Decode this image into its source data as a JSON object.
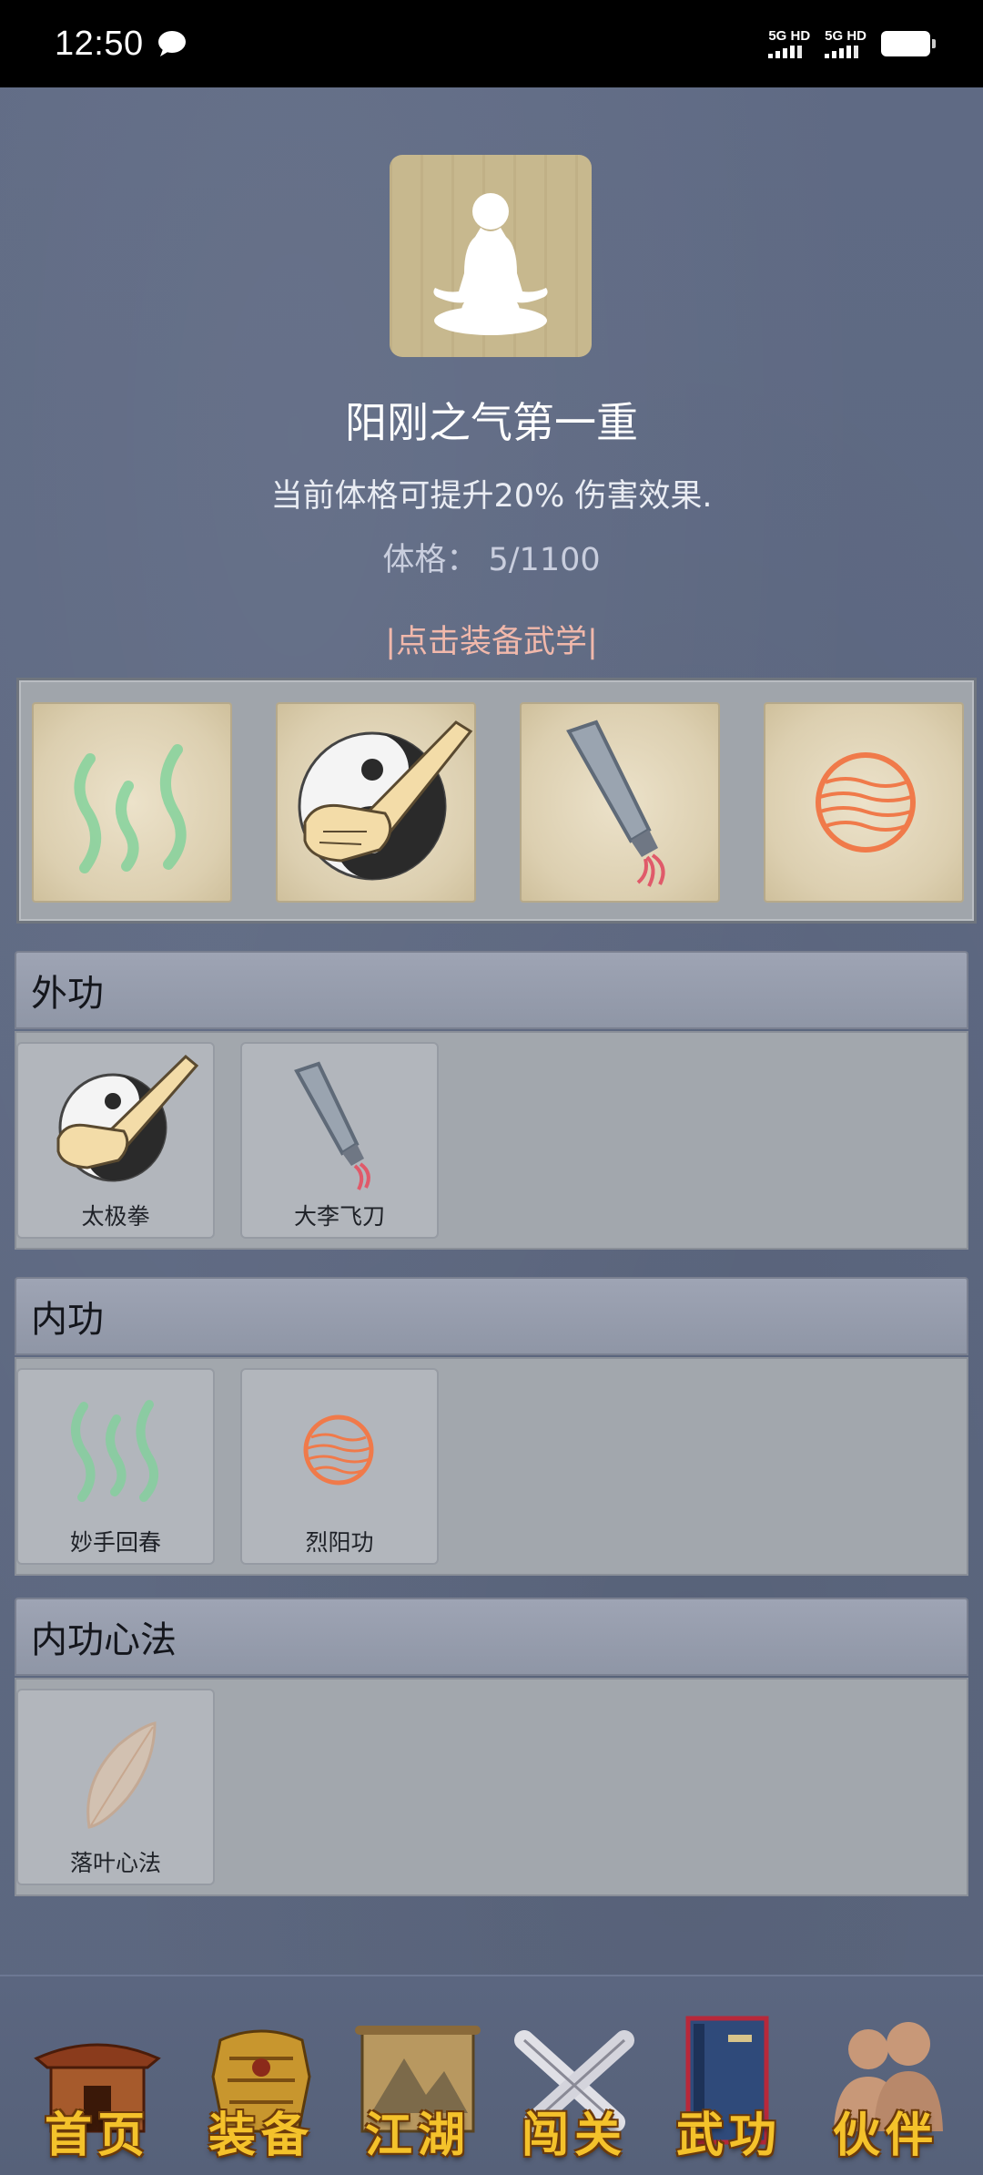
{
  "status_bar": {
    "time": "12:50",
    "network1": "5G HD",
    "network2": "5G HD",
    "icons": [
      "message-icon",
      "signal-icon",
      "battery-icon"
    ]
  },
  "header": {
    "title": "阳刚之气第一重",
    "description": "当前体格可提升20% 伤害效果.",
    "stat_text": "体格： 5/1100",
    "equip_hint": "|点击装备武学|"
  },
  "equipped_slots": [
    {
      "icon": "green-wisps-icon"
    },
    {
      "icon": "taiji-fist-icon"
    },
    {
      "icon": "flying-blade-icon"
    },
    {
      "icon": "fire-orb-icon"
    }
  ],
  "sections": {
    "external": {
      "title": "外功",
      "items": [
        {
          "label": "太极拳",
          "icon": "taiji-fist-icon"
        },
        {
          "label": "大李飞刀",
          "icon": "flying-blade-icon"
        }
      ]
    },
    "internal": {
      "title": "内功",
      "items": [
        {
          "label": "妙手回春",
          "icon": "green-wisps-icon"
        },
        {
          "label": "烈阳功",
          "icon": "fire-orb-icon"
        }
      ]
    },
    "mental": {
      "title": "内功心法",
      "items": [
        {
          "label": "落叶心法",
          "icon": "leaf-icon"
        }
      ]
    }
  },
  "bottom_nav": [
    {
      "label": "首页",
      "icon": "pavilion-icon"
    },
    {
      "label": "装备",
      "icon": "armor-icon"
    },
    {
      "label": "江湖",
      "icon": "scroll-map-icon"
    },
    {
      "label": "闯关",
      "icon": "crossed-swords-icon"
    },
    {
      "label": "武功",
      "icon": "book-icon"
    },
    {
      "label": "伙伴",
      "icon": "companions-icon"
    }
  ],
  "colors": {
    "background": "#5f6a82",
    "hint": "#f1b8ab",
    "nav_label": "#f4c22b"
  }
}
